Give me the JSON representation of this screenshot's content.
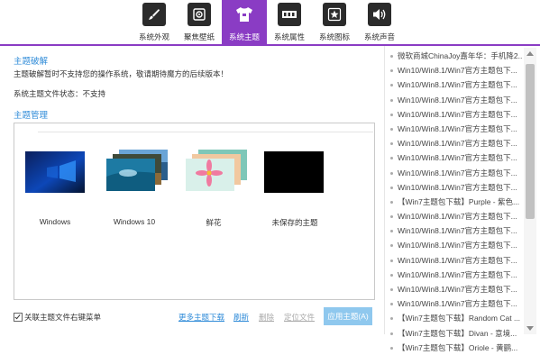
{
  "toolbar": {
    "tabs": [
      {
        "label": "系统外观",
        "icon": "brush-icon",
        "active": false
      },
      {
        "label": "聚焦壁纸",
        "icon": "focus-icon",
        "active": false
      },
      {
        "label": "系统主题",
        "icon": "shirt-icon",
        "active": true
      },
      {
        "label": "系统属性",
        "icon": "ram-icon",
        "active": false
      },
      {
        "label": "系统图标",
        "icon": "star-icon",
        "active": false
      },
      {
        "label": "系统声音",
        "icon": "speaker-icon",
        "active": false
      }
    ]
  },
  "crack": {
    "title": "主题破解",
    "notice": "主题破解暂时不支持您的操作系统，敬请期待魔方的后续版本！",
    "status_text": "系统主题文件状态：不支持"
  },
  "manage": {
    "title": "主题管理",
    "themes": [
      {
        "name": "Windows"
      },
      {
        "name": "Windows 10"
      },
      {
        "name": "鲜花"
      },
      {
        "name": "未保存的主题"
      }
    ]
  },
  "footer": {
    "checkbox_label": "关联主题文件右键菜单",
    "more_link": "更多主题下载",
    "refresh_link": "刷新",
    "delete_link": "删除",
    "locate_link": "定位文件",
    "apply_button": "应用主题(A)"
  },
  "news": [
    "微软商城ChinaJoy嘉年华：手机降2...",
    "Win10/Win8.1/Win7官方主题包下...",
    "Win10/Win8.1/Win7官方主题包下...",
    "Win10/Win8.1/Win7官方主题包下...",
    "Win10/Win8.1/Win7官方主题包下...",
    "Win10/Win8.1/Win7官方主题包下...",
    "Win10/Win8.1/Win7官方主题包下...",
    "Win10/Win8.1/Win7官方主题包下...",
    "Win10/Win8.1/Win7官方主题包下...",
    "Win10/Win8.1/Win7官方主题包下...",
    "【Win7主题包下载】Purple - 紫色...",
    "Win10/Win8.1/Win7官方主题包下...",
    "Win10/Win8.1/Win7官方主题包下...",
    "Win10/Win8.1/Win7官方主题包下...",
    "Win10/Win8.1/Win7官方主题包下...",
    "Win10/Win8.1/Win7官方主题包下...",
    "Win10/Win8.1/Win7官方主题包下...",
    "Win10/Win8.1/Win7官方主题包下...",
    "【Win7主题包下载】Random Cat ...",
    "【Win7主题包下载】Divan - 意境...",
    "【Win7主题包下载】Oriole - 黄鹂..."
  ],
  "colors": {
    "accent": "#8a3cc4",
    "link": "#2f8bd8",
    "apply_button": "#8fc8ee"
  }
}
